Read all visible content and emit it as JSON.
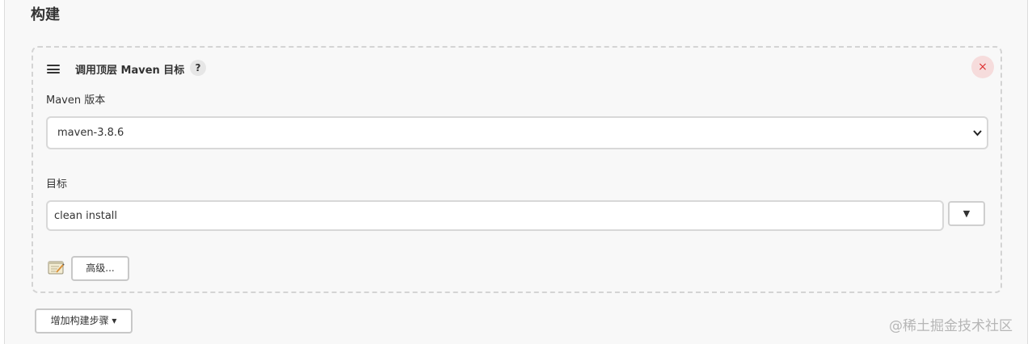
{
  "section": {
    "title": "构建"
  },
  "build_step": {
    "title": "调用顶层 Maven 目标",
    "help_label": "?",
    "close_label": "×",
    "maven_version": {
      "label": "Maven 版本",
      "selected": "maven-3.8.6",
      "arrow": "⌄"
    },
    "goals": {
      "label": "目标",
      "value": "clean install",
      "expand_label": "▼"
    },
    "advanced_label": "高级..."
  },
  "add_step": {
    "label": "增加构建步骤 ▾"
  },
  "watermark": "@稀土掘金技术社区"
}
